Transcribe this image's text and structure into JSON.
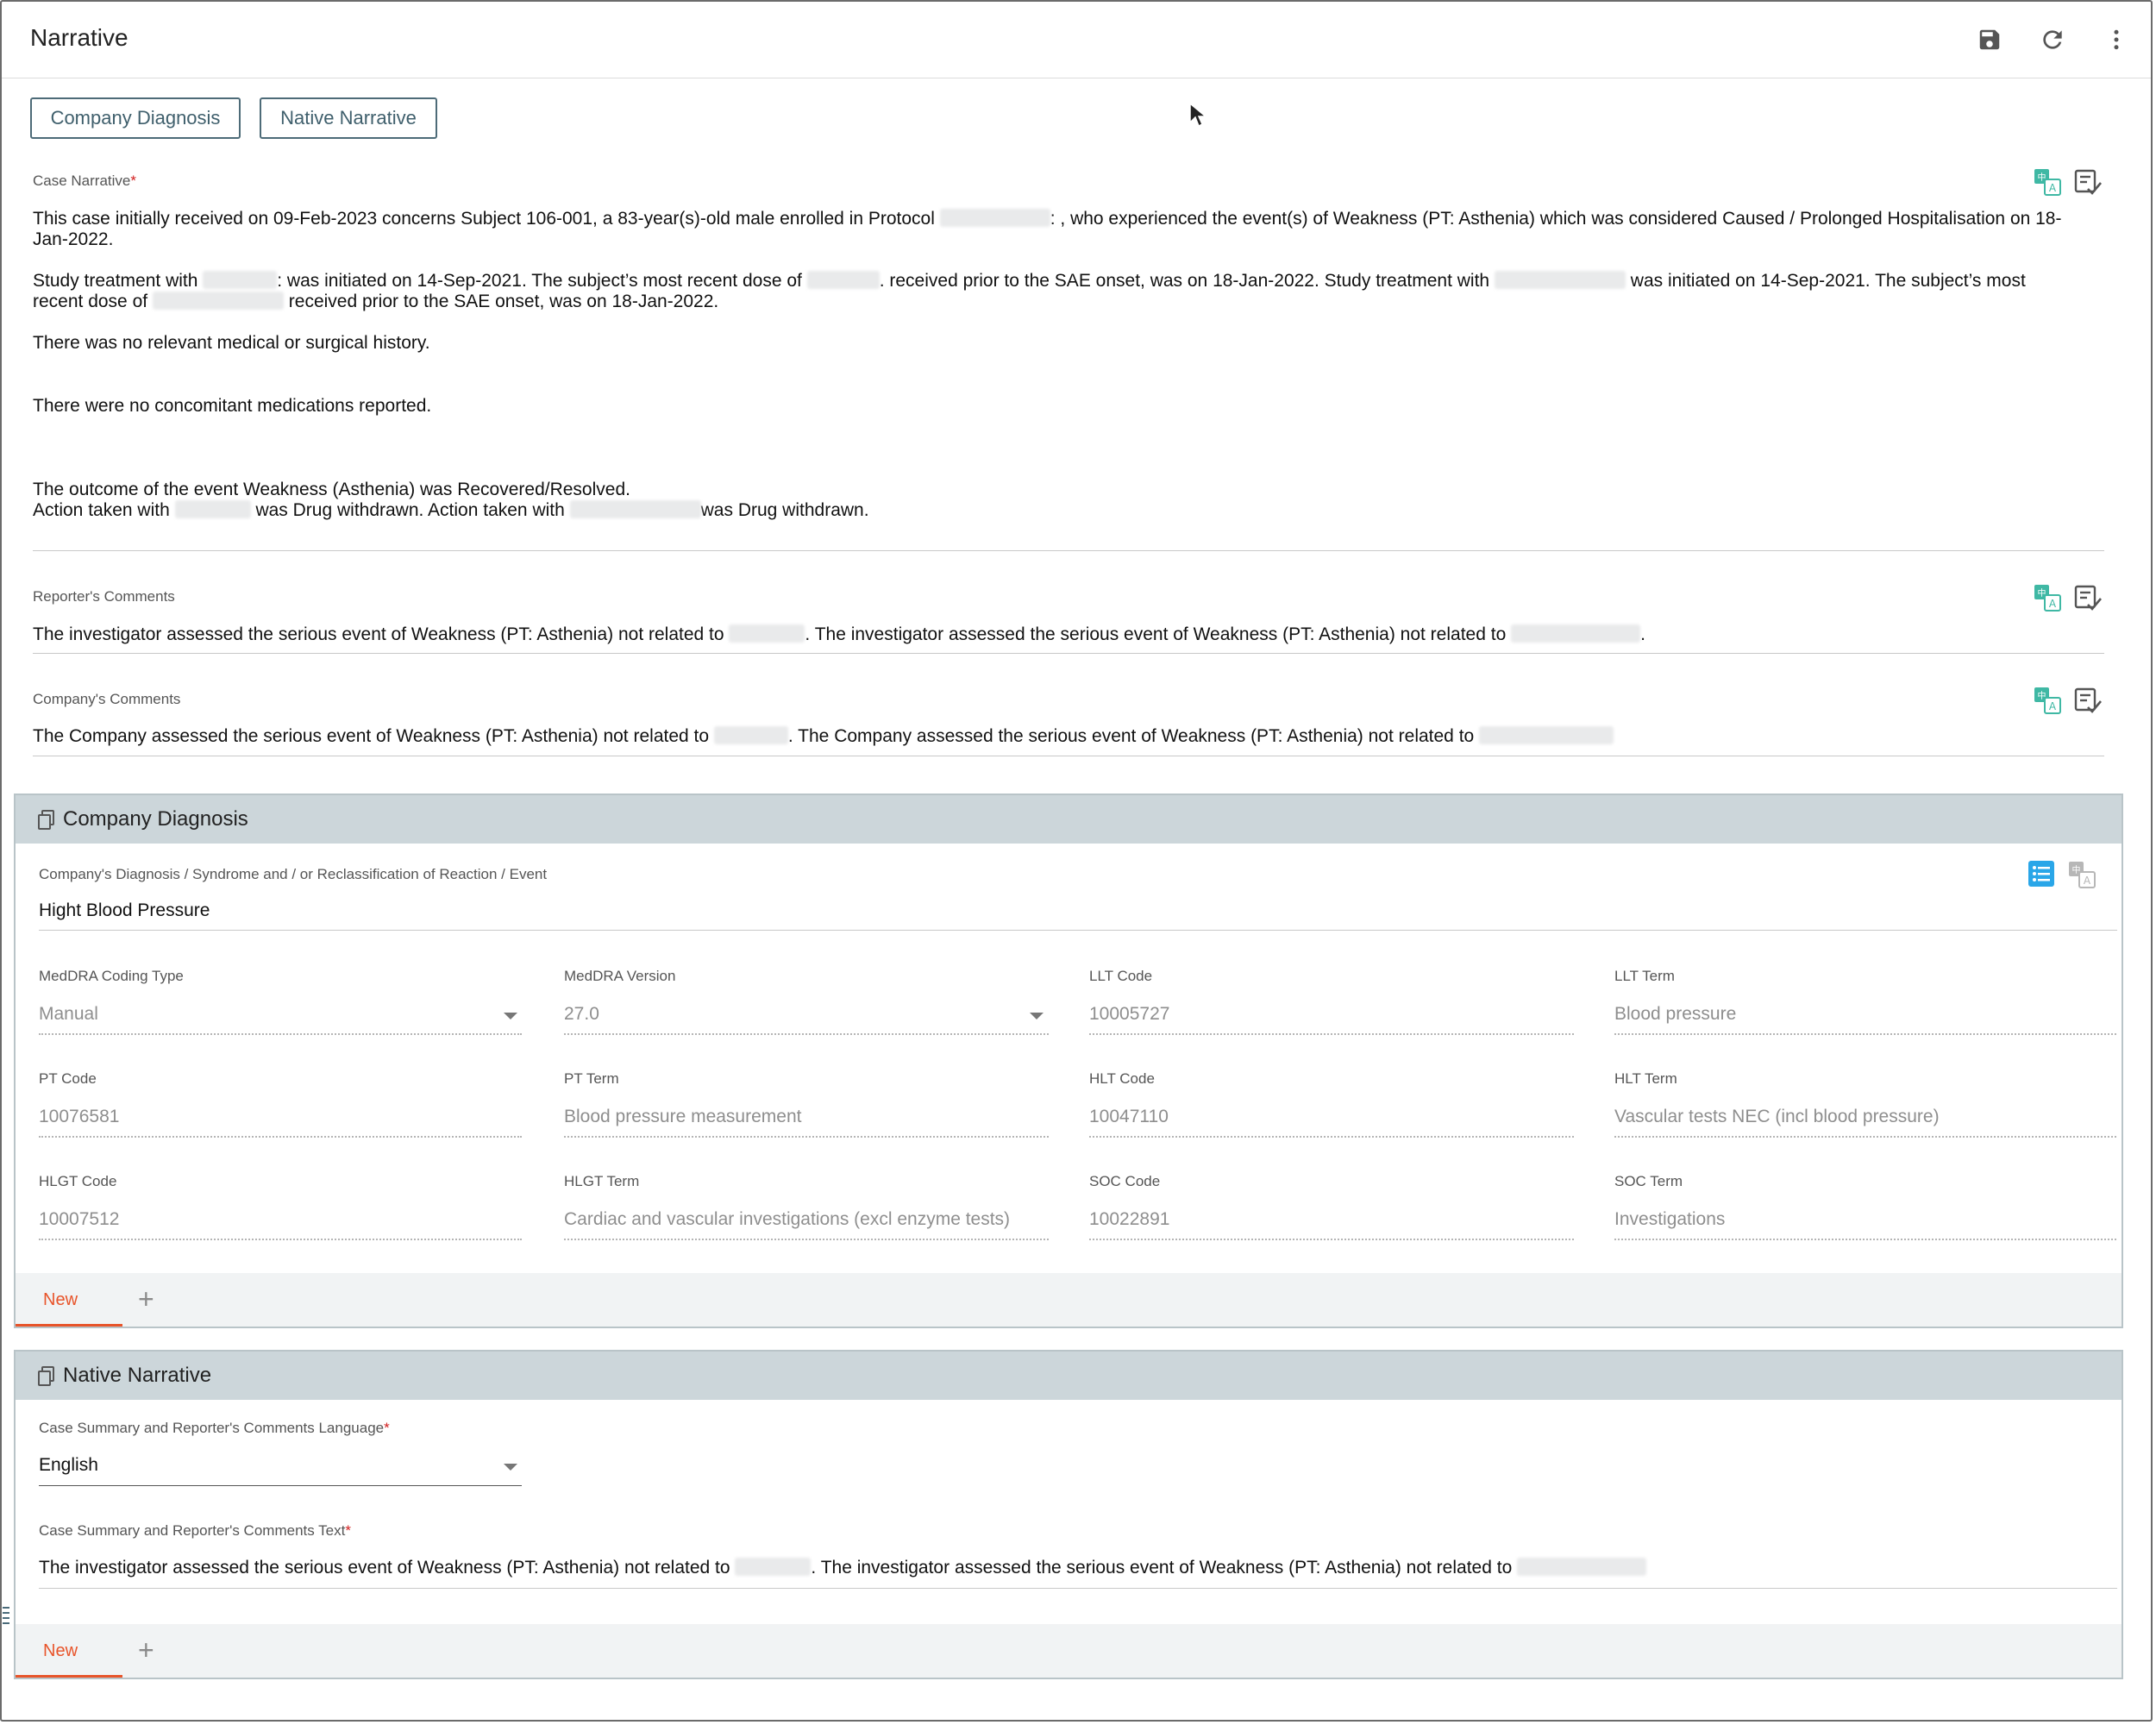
{
  "header": {
    "title": "Narrative",
    "icons": [
      "save-icon",
      "refresh-icon",
      "more-vert-icon"
    ]
  },
  "tabs": [
    {
      "label": "Company Diagnosis"
    },
    {
      "label": "Native Narrative"
    }
  ],
  "case_narrative": {
    "label": "Case Narrative",
    "required_mark": "*",
    "p1a": "This case initially received on 09-Feb-2023 concerns Subject 106-001, a 83-year(s)-old male enrolled in Protocol",
    "p1b": ": , who experienced the event(s) of Weakness (PT: Asthenia) which was considered Caused / Prolonged Hospitalisation on 18-",
    "p1c": "Jan-2022.",
    "p2a": "Study treatment with",
    "p2b": ": was initiated on 14-Sep-2021. The subject’s most recent dose of",
    "p2c": ". received prior to the SAE onset, was on 18-Jan-2022. Study treatment with",
    "p2d": "was initiated on 14-Sep-2021. The subject’s most",
    "p2e": "recent dose of",
    "p2f": "received prior to the SAE onset, was on 18-Jan-2022.",
    "p3": "There was no relevant medical or surgical history.",
    "p4": "There were no concomitant medications reported.",
    "p5": "The outcome of the event Weakness (Asthenia) was Recovered/Resolved.",
    "p6a": "Action taken with",
    "p6b": "was Drug withdrawn. Action taken with",
    "p6c": "was Drug withdrawn."
  },
  "reporters_comments": {
    "label": "Reporter's Comments",
    "t1": "The investigator assessed the serious event of Weakness (PT: Asthenia) not related to",
    "t2": ". The investigator assessed the serious event of Weakness (PT: Asthenia) not related to",
    "t3": "."
  },
  "companys_comments": {
    "label": "Company's Comments",
    "t1": "The Company assessed the serious event of Weakness (PT: Asthenia) not related to",
    "t2": ". The Company assessed the serious event of Weakness (PT: Asthenia) not related to"
  },
  "company_diagnosis": {
    "title": "Company Diagnosis",
    "field_label": "Company's Diagnosis / Syndrome and / or Reclassification of Reaction / Event",
    "field_value": "Hight Blood Pressure",
    "grid": [
      {
        "label": "MedDRA Coding Type",
        "value": "Manual",
        "dropdown": true
      },
      {
        "label": "MedDRA Version",
        "value": "27.0",
        "dropdown": true
      },
      {
        "label": "LLT Code",
        "value": "10005727"
      },
      {
        "label": "LLT Term",
        "value": "Blood pressure"
      },
      {
        "label": "PT Code",
        "value": "10076581"
      },
      {
        "label": "PT Term",
        "value": "Blood pressure measurement"
      },
      {
        "label": "HLT Code",
        "value": "10047110"
      },
      {
        "label": "HLT Term",
        "value": "Vascular tests NEC (incl blood pressure)"
      },
      {
        "label": "HLGT Code",
        "value": "10007512"
      },
      {
        "label": "HLGT Term",
        "value": "Cardiac and vascular investigations (excl enzyme tests)"
      },
      {
        "label": "SOC Code",
        "value": "10022891"
      },
      {
        "label": "SOC Term",
        "value": "Investigations"
      }
    ],
    "new_tab": "New",
    "add_symbol": "+"
  },
  "native_narrative": {
    "title": "Native Narrative",
    "language_label": "Case Summary and Reporter's Comments Language",
    "language_value": "English",
    "text_label": "Case Summary and Reporter's Comments Text",
    "t1": "The investigator assessed the serious event of Weakness (PT: Asthenia) not related to",
    "t2": ". The investigator assessed the serious event of Weakness (PT: Asthenia) not related to",
    "new_tab": "New",
    "add_symbol": "+"
  },
  "colors": {
    "accent_orange": "#e8542a",
    "panel_header": "#ccd6da",
    "translate_icon": "#3fb8a4",
    "list_icon_active": "#2aa6e8"
  }
}
